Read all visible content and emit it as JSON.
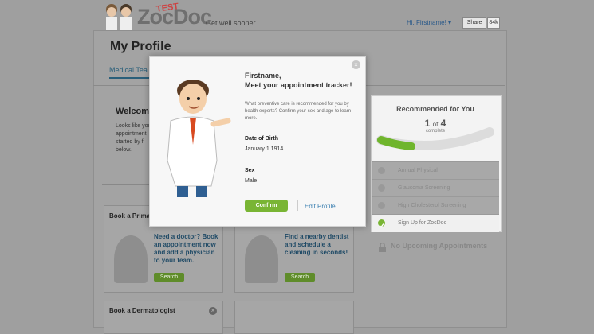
{
  "header": {
    "logo": "ZocDoc",
    "logo_badge": "TEST",
    "tagline": "Get well sooner",
    "greeting": "Hi, Firstname! ▾",
    "fb_share": "Share",
    "fb_count": "84k"
  },
  "page": {
    "title": "My Profile",
    "tab_medical": "Medical Tea"
  },
  "welcome": {
    "heading": "Welcom",
    "text": "Looks like you appointment started by fi below."
  },
  "cards": [
    {
      "title": "Book a Prima",
      "text": "Need a doctor? Book an appointment now and add a physician to your team.",
      "button": "Search"
    },
    {
      "title": "",
      "text": "Find a nearby dentist and schedule a cleaning in seconds!",
      "button": "Search"
    },
    {
      "title": "Book a Dermatologist",
      "close": "×"
    }
  ],
  "recommended": {
    "title": "Recommended for You",
    "count_done": "1",
    "count_of": "of",
    "count_total": "4",
    "progress": 0.25,
    "complete_label": "complete",
    "items": [
      {
        "label": "Annual Physical",
        "done": false
      },
      {
        "label": "Glaucoma Screening",
        "done": false
      },
      {
        "label": "High Cholesterol Screening",
        "done": false
      },
      {
        "label": "Sign Up for ZocDoc",
        "done": true
      }
    ],
    "upcoming": "No Upcoming Appointments"
  },
  "modal": {
    "title_line1": "Firstname,",
    "title_line2": "Meet your appointment tracker!",
    "description": "What preventive care is recommended for you by health experts? Confirm your sex and age to learn more.",
    "dob_label": "Date of Birth",
    "dob_value": "January 1 1914",
    "sex_label": "Sex",
    "sex_value": "Male",
    "confirm_label": "Confirm",
    "edit_label": "Edit Profile",
    "close": "×"
  },
  "colors": {
    "accent_green": "#79b534",
    "link_blue": "#3a7fb0",
    "overlay": "#9f9f9f"
  }
}
